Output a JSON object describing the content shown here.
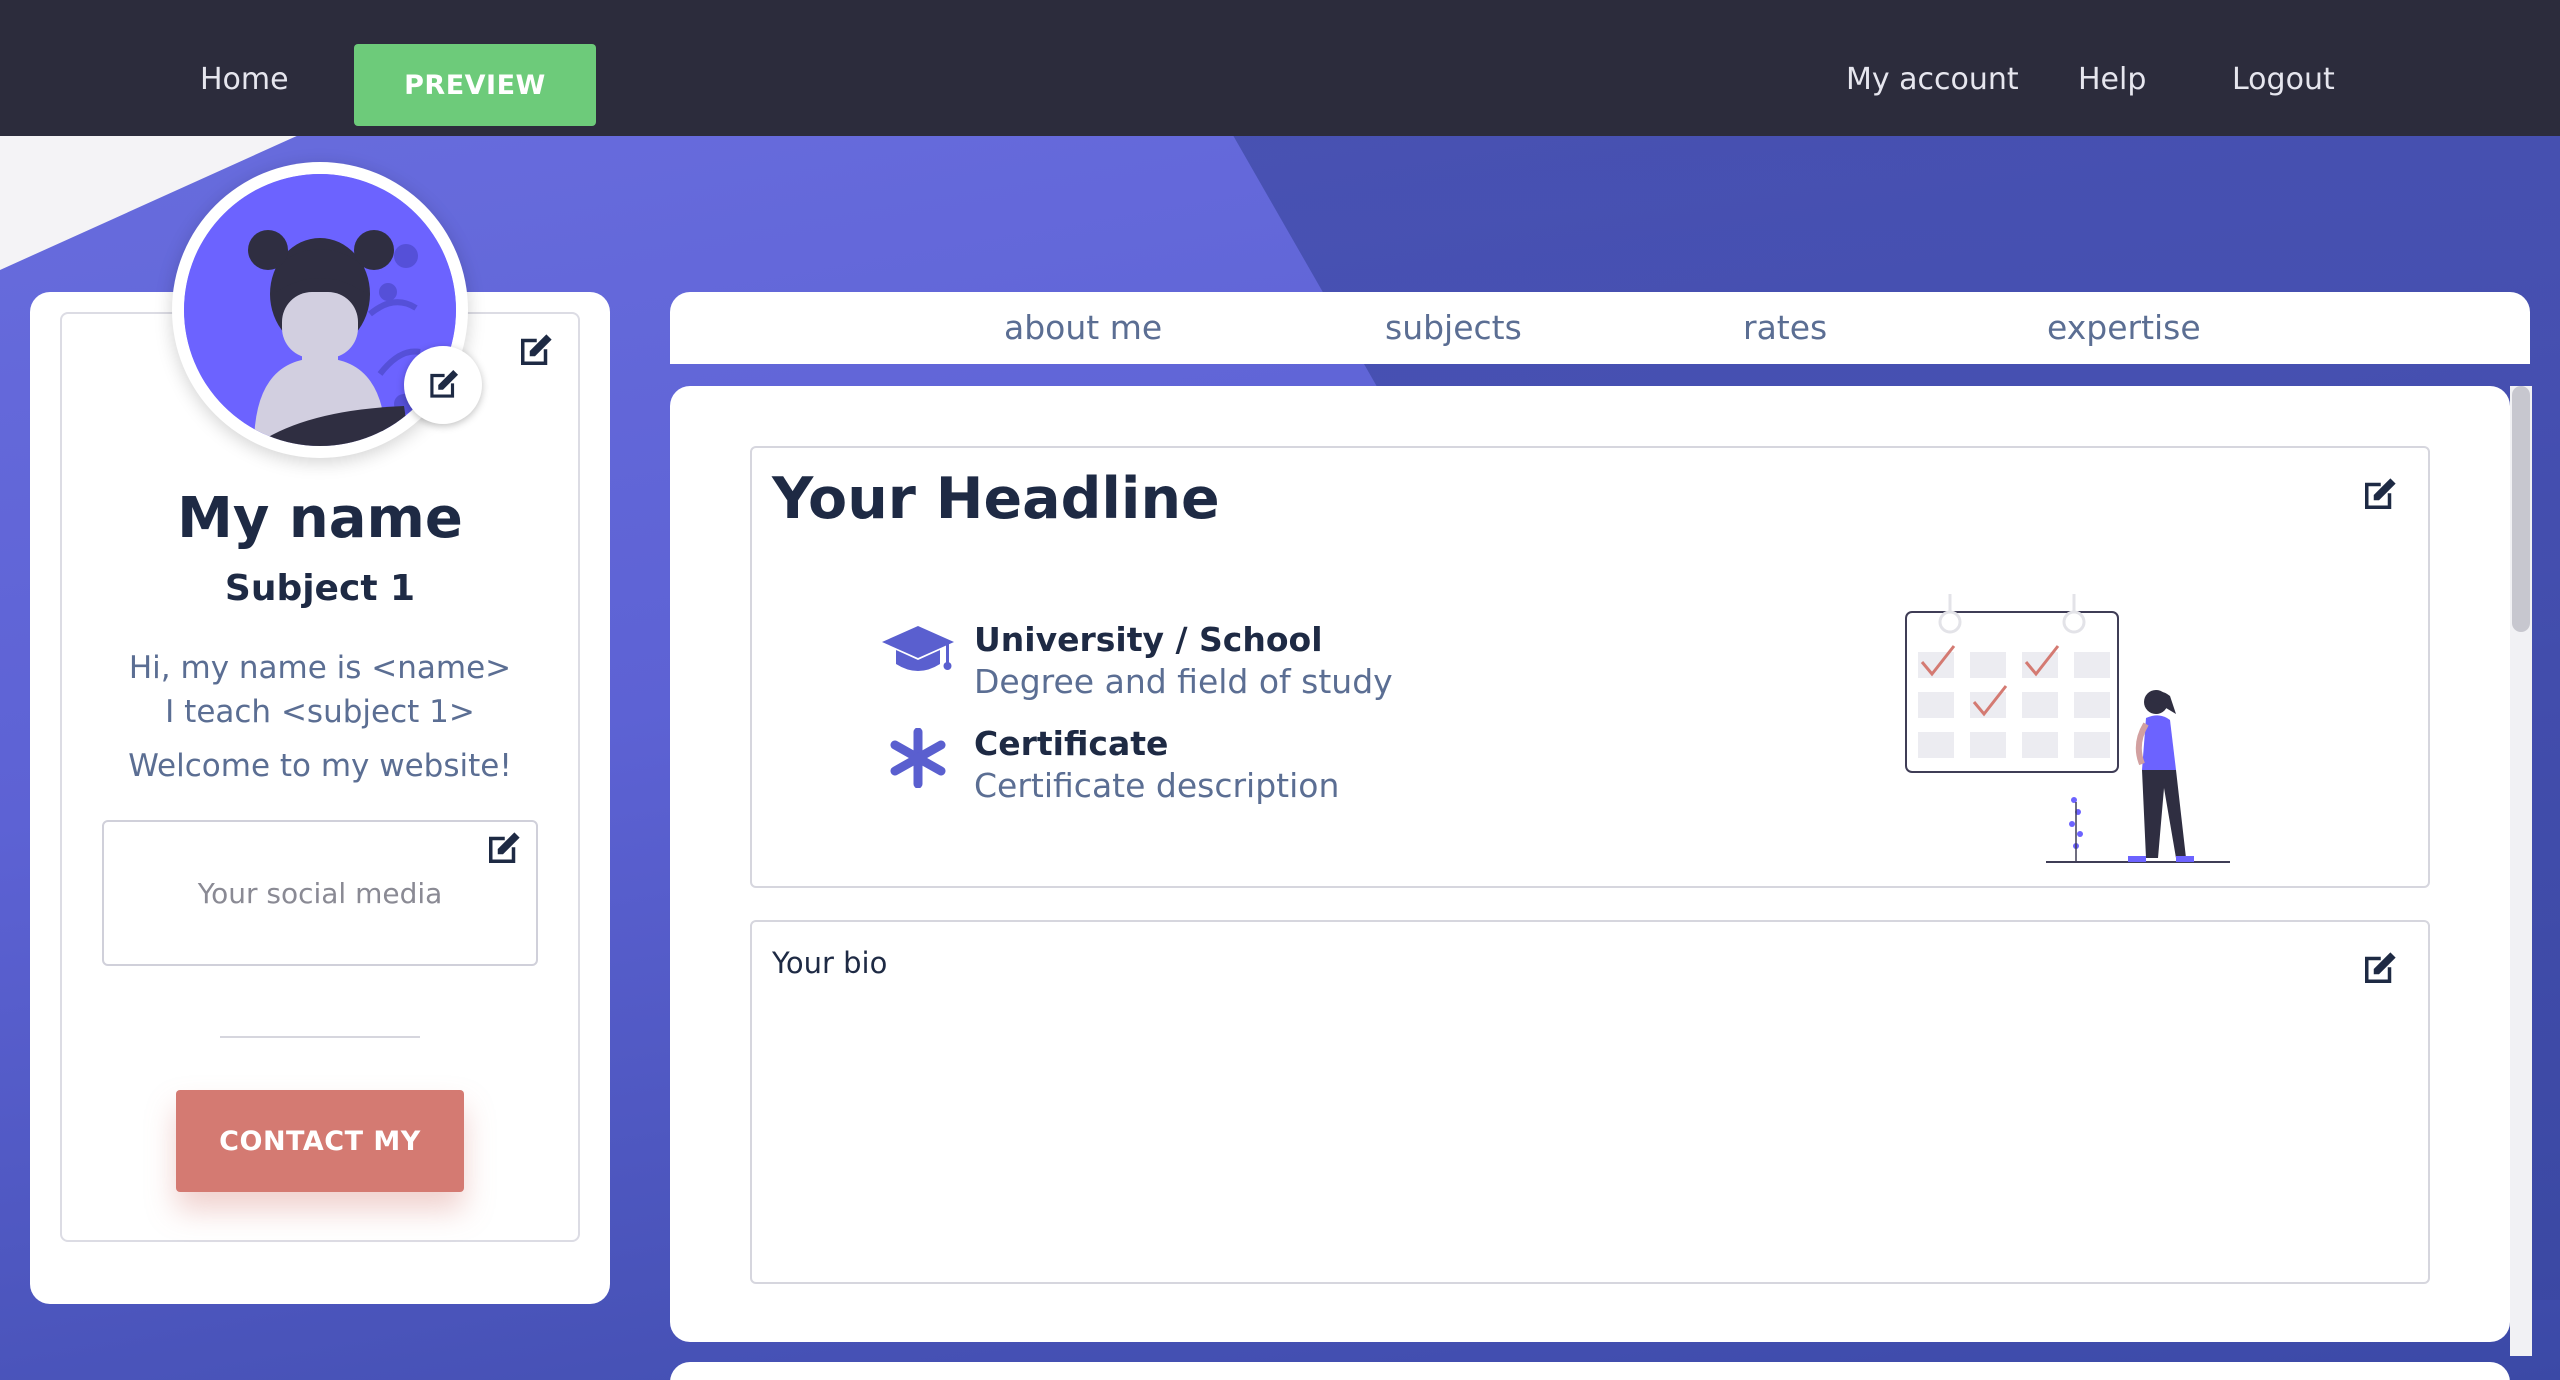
{
  "nav": {
    "home": "Home",
    "preview": "PREVIEW",
    "my_account": "My account",
    "help": "Help",
    "logout": "Logout"
  },
  "profile": {
    "name": "My name",
    "subject": "Subject 1",
    "intro_line1": "Hi, my name is <name>",
    "intro_line2": "I teach <subject 1>",
    "intro_line3": "Welcome to my website!",
    "social_placeholder": "Your social media",
    "contact_button": "CONTACT MY"
  },
  "tabs": [
    "about me",
    "subjects",
    "rates",
    "expertise"
  ],
  "main": {
    "headline": "Your Headline",
    "education": [
      {
        "icon": "graduation-cap-icon",
        "title": "University / School",
        "subtitle": "Degree and field of study"
      },
      {
        "icon": "asterisk-icon",
        "title": "Certificate",
        "subtitle": "Certificate description"
      }
    ],
    "bio": "Your bio"
  },
  "colors": {
    "nav_bg": "#2c2c3c",
    "preview_green": "#6dcb7a",
    "contact_red": "#d47a72",
    "accent_purple": "#5a5fcf",
    "heading_navy": "#1e2a44",
    "muted_blue": "#5b6e93"
  }
}
